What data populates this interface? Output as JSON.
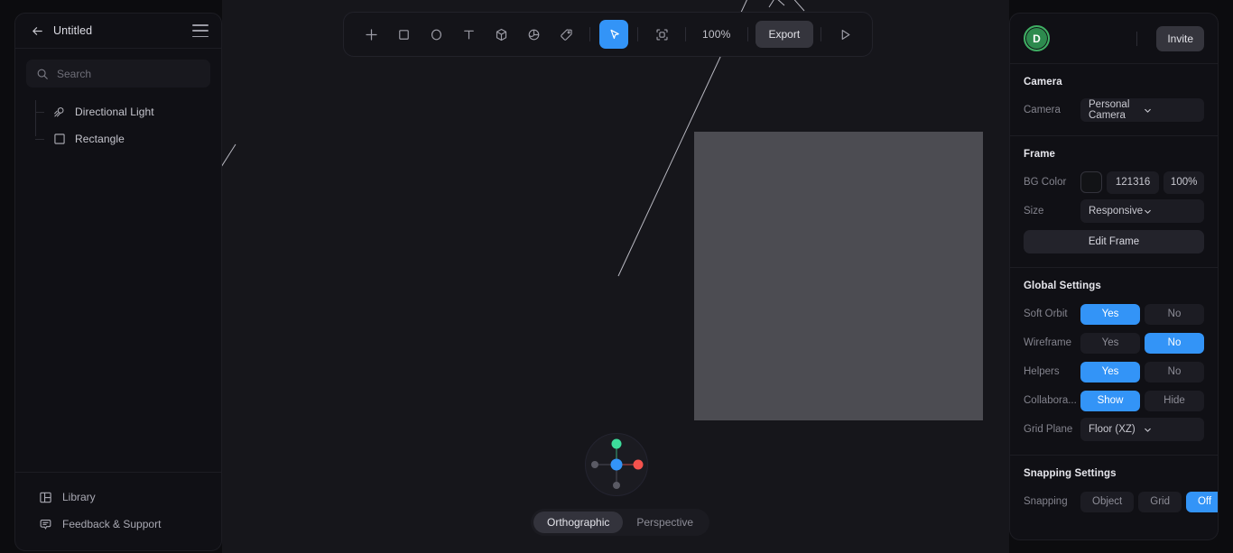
{
  "sidebar": {
    "back_icon": "arrow-left-icon",
    "title": "Untitled",
    "menu_icon": "hamburger-menu-icon",
    "search": {
      "placeholder": "Search",
      "value": "",
      "icon": "search-icon"
    },
    "tree": [
      {
        "label": "Directional Light",
        "icon": "directional-light-icon"
      },
      {
        "label": "Rectangle",
        "icon": "rectangle-icon"
      }
    ],
    "footer": [
      {
        "label": "Library",
        "icon": "library-panel-icon"
      },
      {
        "label": "Feedback & Support",
        "icon": "speech-bubble-icon"
      }
    ]
  },
  "toolbar": {
    "tools": [
      {
        "name": "add-icon",
        "label": ""
      },
      {
        "name": "rectangle-icon",
        "label": ""
      },
      {
        "name": "circle-icon",
        "label": ""
      },
      {
        "name": "text-icon",
        "label": ""
      },
      {
        "name": "cube-icon",
        "label": ""
      },
      {
        "name": "sphere-icon",
        "label": ""
      },
      {
        "name": "tag-icon",
        "label": ""
      }
    ],
    "cursor_icon": "cursor-arrow-icon",
    "frame_icon": "frame-select-icon",
    "zoom_level": "100%",
    "export_label": "Export",
    "play_icon": "play-icon"
  },
  "viewport": {
    "projection": {
      "options": [
        "Orthographic",
        "Perspective"
      ],
      "selected": "Orthographic"
    },
    "gizmo": {
      "axis_colors": {
        "x": "#f4524d",
        "y": "#3ddc9b",
        "center": "#3394f7",
        "inactive": "#5a5a64"
      }
    }
  },
  "right_panel": {
    "avatar_initial": "D",
    "invite_label": "Invite",
    "camera": {
      "title": "Camera",
      "camera_label": "Camera",
      "camera_value": "Personal Camera"
    },
    "frame": {
      "title": "Frame",
      "bg_color_label": "BG Color",
      "bg_color_hex": "121316",
      "bg_color_opacity": "100%",
      "size_label": "Size",
      "size_value": "Responsive",
      "edit_frame_label": "Edit Frame"
    },
    "global_settings": {
      "title": "Global Settings",
      "rows": [
        {
          "label": "Soft Orbit",
          "options": [
            "Yes",
            "No"
          ],
          "selected": "Yes"
        },
        {
          "label": "Wireframe",
          "options": [
            "Yes",
            "No"
          ],
          "selected": "No"
        },
        {
          "label": "Helpers",
          "options": [
            "Yes",
            "No"
          ],
          "selected": "Yes"
        },
        {
          "label": "Collabora...",
          "options": [
            "Show",
            "Hide"
          ],
          "selected": "Show"
        }
      ],
      "grid_plane_label": "Grid Plane",
      "grid_plane_value": "Floor (XZ)"
    },
    "snapping_settings": {
      "title": "Snapping Settings",
      "snapping_label": "Snapping",
      "options": [
        "Object",
        "Grid",
        "Off"
      ],
      "selected": "Off"
    }
  },
  "colors": {
    "accent_blue": "#3394f7",
    "avatar_green": "#3fae63",
    "canvas_bg": "#16161b",
    "object_fill": "#4c4c52",
    "panel_bg": "#101015"
  }
}
